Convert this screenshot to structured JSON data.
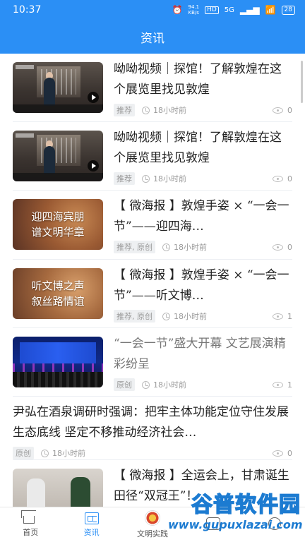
{
  "status": {
    "time": "10:37",
    "net_speed": "94.1\nKB/s",
    "net_type": "5G",
    "battery": "28"
  },
  "header": {
    "title": "资讯"
  },
  "feed": [
    {
      "title": "呦呦视频｜探馆！了解敦煌在这个展览里找见敦煌",
      "tag": "推荐",
      "time": "18小时前",
      "views": "0",
      "thumb_caption": ""
    },
    {
      "title": "呦呦视频｜探馆！了解敦煌在这个展览里找见敦煌",
      "tag": "推荐",
      "time": "18小时前",
      "views": "0",
      "thumb_caption": ""
    },
    {
      "title": "【 微海报 】敦煌手姿 × “一会一节”——迎四海…",
      "tag": "推荐, 原创",
      "time": "18小时前",
      "views": "0",
      "thumb_caption": "迎四海宾朋\n谱文明华章"
    },
    {
      "title": "【 微海报 】敦煌手姿 × “一会一节”——听文博…",
      "tag": "推荐, 原创",
      "time": "18小时前",
      "views": "1",
      "thumb_caption": "听文博之声\n叙丝路情谊"
    },
    {
      "title": "“一会一节”盛大开幕 文艺展演精彩纷呈",
      "tag": "原创",
      "time": "18小时前",
      "views": "1",
      "thumb_caption": ""
    },
    {
      "title": "尹弘在酒泉调研时强调：把牢主体功能定位守住发展生态底线 坚定不移推动经济社会…",
      "tag": "原创",
      "time": "18小时前",
      "views": "0"
    },
    {
      "title": "【 微海报 】全运会上，甘肃诞生田径“双冠王”！",
      "tag": "",
      "time": "",
      "views": ""
    }
  ],
  "tabs": [
    {
      "label": "首页",
      "icon": "home-icon"
    },
    {
      "label": "资讯",
      "icon": "news-icon",
      "active": true
    },
    {
      "label": "文明实践",
      "icon": "civilization-icon"
    },
    {
      "label": "",
      "icon": "square-icon"
    },
    {
      "label": "",
      "icon": "user-icon"
    }
  ],
  "watermark": {
    "title": "谷普软件园",
    "url": "www.gupuxlazai.com"
  },
  "colors": {
    "brand": "#2b8ff5"
  }
}
